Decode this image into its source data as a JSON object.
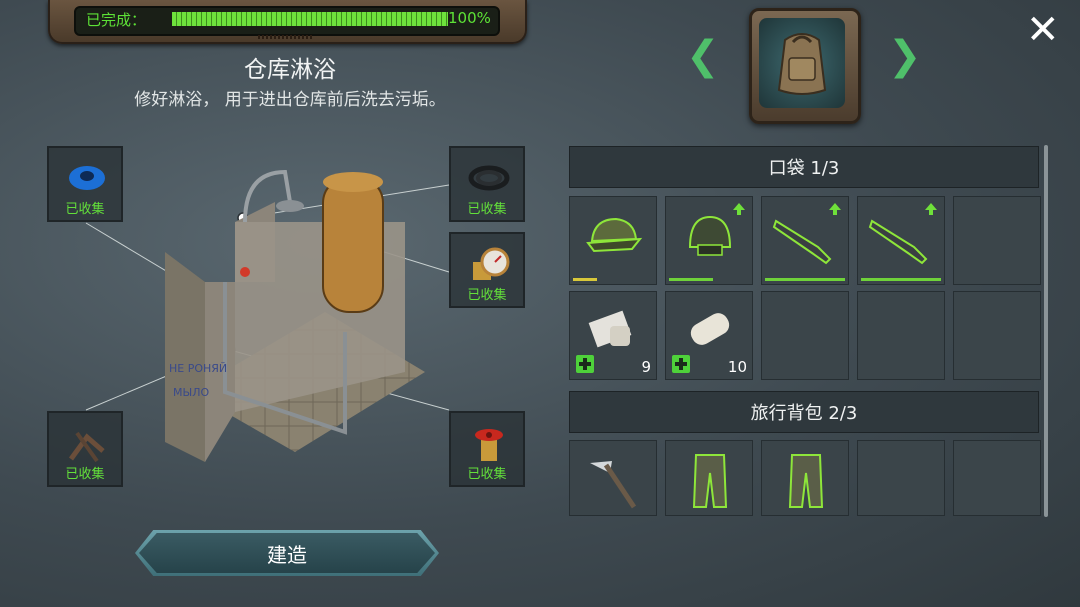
{
  "progress": {
    "label": "已完成：",
    "percent": "100%",
    "fraction": 1.0
  },
  "title": "仓库淋浴",
  "subtitle": "修好淋浴， 用于进出仓库前后洗去污垢。",
  "nav": {
    "prev_icon": "chevron-left-icon",
    "next_icon": "chevron-right-icon",
    "current_icon": "backpack-icon"
  },
  "close_icon": "close-icon",
  "materials": [
    {
      "name": "blue-tape",
      "status": "已收集"
    },
    {
      "name": "hose",
      "status": "已收集"
    },
    {
      "name": "pressure-gauge",
      "status": "已收集"
    },
    {
      "name": "pipes",
      "status": "已收集"
    },
    {
      "name": "valve",
      "status": "已收集"
    }
  ],
  "build_button": "建造",
  "pocket": {
    "header": "口袋 1/3",
    "items": [
      {
        "icon": "cap-icon",
        "bar_color": "#d8c83a",
        "bar_fraction": 0.3
      },
      {
        "icon": "helmet-icon",
        "bar_color": "#6fd23a",
        "bar_fraction": 0.55,
        "upgrade": true
      },
      {
        "icon": "shotgun-icon",
        "bar_color": "#6fd23a",
        "bar_fraction": 1.0,
        "upgrade": true
      },
      {
        "icon": "shotgun-icon",
        "bar_color": "#6fd23a",
        "bar_fraction": 1.0,
        "upgrade": true
      },
      {
        "icon": "",
        "empty": true
      },
      {
        "icon": "bandage-icon",
        "count": "9",
        "medical": true
      },
      {
        "icon": "bandage-roll-icon",
        "count": "10",
        "medical": true
      },
      {
        "icon": "",
        "empty": true
      },
      {
        "icon": "",
        "empty": true
      },
      {
        "icon": "",
        "empty": true
      }
    ]
  },
  "backpack": {
    "header": "旅行背包 2/3",
    "items": [
      {
        "icon": "hatchet-icon"
      },
      {
        "icon": "pants-icon"
      },
      {
        "icon": "pants-icon"
      },
      {
        "icon": "",
        "empty": true
      },
      {
        "icon": "",
        "empty": true
      }
    ]
  },
  "colors": {
    "accent_green": "#63e03a",
    "progress_green": "#6ee23c",
    "nav_green": "#4fc06a"
  }
}
